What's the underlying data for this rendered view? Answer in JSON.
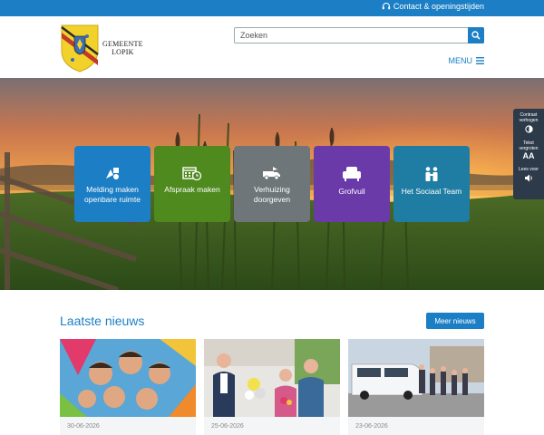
{
  "topbar": {
    "contact_label": "Contact & openingstijden"
  },
  "header": {
    "logo_line1": "GEMEENTE",
    "logo_line2": "LOPIK",
    "search_placeholder": "Zoeken",
    "menu_label": "MENU"
  },
  "tiles": [
    {
      "label": "Melding maken openbare ruimte",
      "color": "#1c7fc5",
      "icon": "report-icon"
    },
    {
      "label": "Afspraak maken",
      "color": "#4e8a1d",
      "icon": "calendar-icon"
    },
    {
      "label": "Verhuizing doorgeven",
      "color": "#6f7679",
      "icon": "moving-truck-icon"
    },
    {
      "label": "Grofvuil",
      "color": "#6a3aa8",
      "icon": "armchair-icon"
    },
    {
      "label": "Het Sociaal Team",
      "color": "#1f7ca3",
      "icon": "team-icon"
    }
  ],
  "accessibility": {
    "contrast_label": "Contrast verhogen",
    "text_label": "Tekst vergroten",
    "text_symbol": "AA",
    "read_label": "Lees voor"
  },
  "news": {
    "title": "Laatste nieuws",
    "more_label": "Meer nieuws",
    "cards": [
      {
        "date": "30-06-2026"
      },
      {
        "date": "25-06-2026"
      },
      {
        "date": "23-06-2026"
      }
    ]
  }
}
